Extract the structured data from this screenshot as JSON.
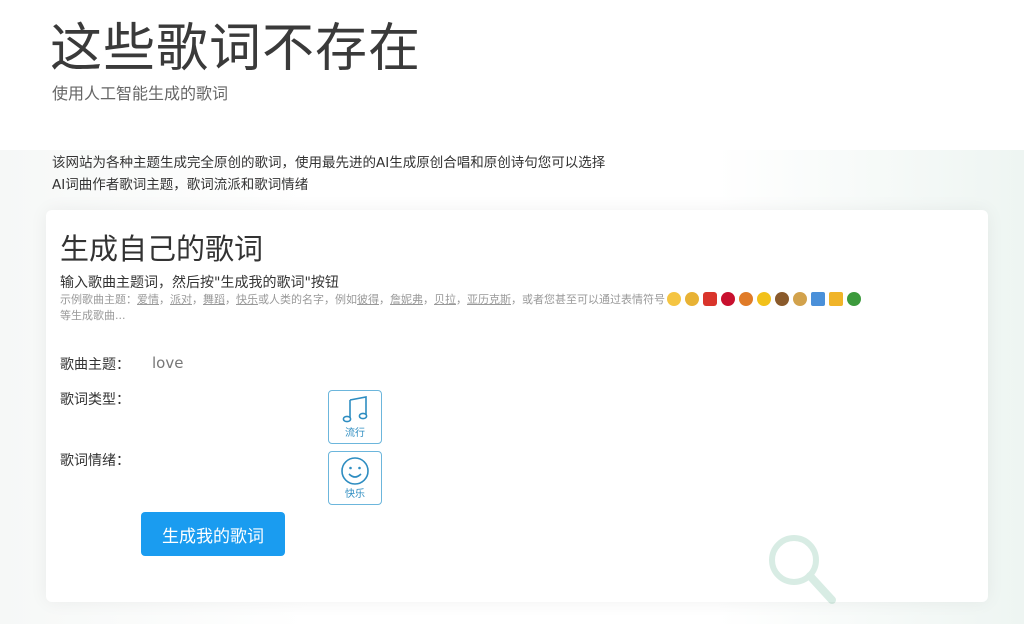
{
  "header": {
    "title": "这些歌词不存在",
    "subtitle": "使用人工智能生成的歌词"
  },
  "intro": {
    "line1": "该网站为各种主题生成完全原创的歌词，使用最先进的AI生成原创合唱和原创诗句您可以选择",
    "line2": "AI词曲作者歌词主题，歌词流派和歌词情绪"
  },
  "card": {
    "title": "生成自己的歌词",
    "instruction": "输入歌曲主题词，然后按\"生成我的歌词\"按钮",
    "examples": {
      "prefix": "示例歌曲主题：",
      "links": [
        "爱情",
        "派对",
        "舞蹈",
        "快乐",
        "彼得",
        "詹妮弗",
        "贝拉",
        "亚历克斯"
      ],
      "sep": "，",
      "or_names": "或人类的名字，例如",
      "emoji_text": "，或者您甚至可以通过表情符号",
      "suffix": "等生成歌曲..."
    },
    "topic_label": "歌曲主题：",
    "topic_value": "love",
    "genre_label": "歌词类型：",
    "genre_option": "流行",
    "mood_label": "歌词情绪：",
    "mood_option": "快乐",
    "generate_label": "生成我的歌词"
  },
  "colors": {
    "accent": "#1a9cf0",
    "option_border": "#6cb6dc"
  },
  "icons": {
    "genre": "music-note-icon",
    "mood": "smiley-face-icon",
    "emojis": [
      "smile",
      "cool",
      "heart",
      "lips",
      "ball",
      "sun",
      "poo",
      "dance",
      "photo",
      "beer",
      "clover"
    ]
  }
}
